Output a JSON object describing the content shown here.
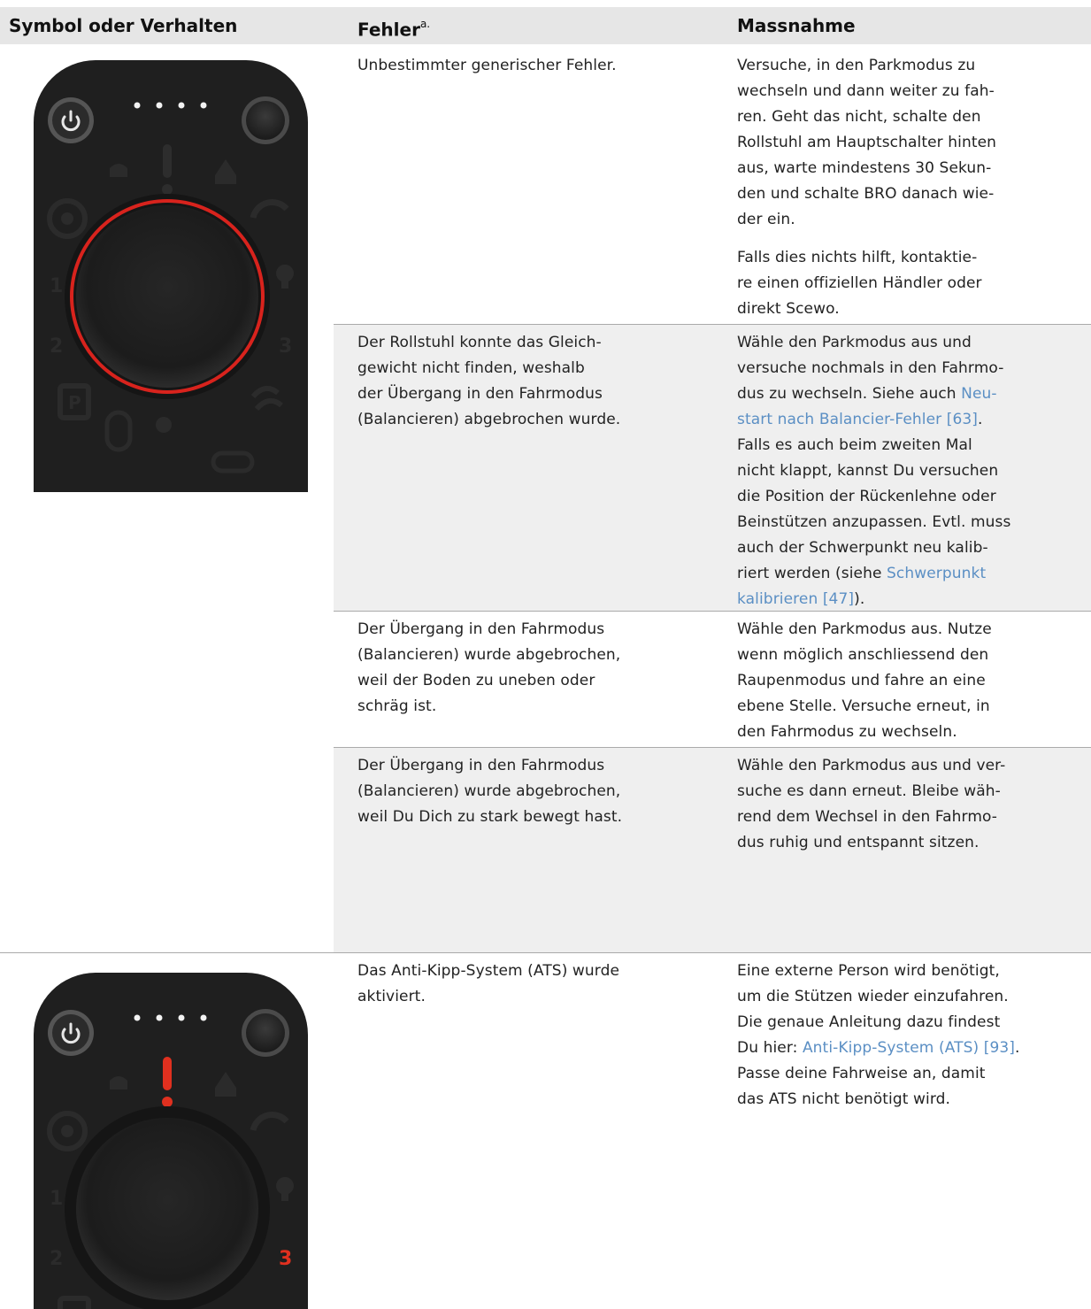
{
  "table": {
    "headers": {
      "symbol": "Symbol oder Verhalten",
      "fehler": "Fehler",
      "fehler_note": "a.",
      "massnahme": "Massnahme"
    },
    "rows": [
      {
        "fehler": "Unbestimmter generischer Fehler.",
        "massnahme_lines": [
          "Versuche, in den Parkmodus zu",
          "wechseln und dann weiter zu fah-",
          "ren. Geht das nicht, schalte den",
          "Rollstuhl am Hauptschalter hinten",
          "aus, warte mindestens 30 Sekun-",
          "den und schalte BRO danach wie-",
          "der ein."
        ],
        "massnahme2_lines": [
          "Falls dies nichts hilft, kontaktie-",
          "re einen offiziellen Händler oder",
          "direkt Scewo."
        ]
      },
      {
        "fehler_lines": [
          "Der Rollstuhl konnte das Gleich-",
          "gewicht nicht finden, weshalb",
          "der Übergang in den Fahrmodus",
          "(Balancieren) abgebrochen wurde."
        ],
        "massnahme": {
          "l1": "Wähle den Parkmodus aus und",
          "l2": "versuche nochmals in den Fahrmo-",
          "l3a": "dus zu wechseln. Siehe auch ",
          "link1a": "Neu-",
          "link1b": "start nach Balancier-Fehler [63]",
          "l4b": ".",
          "l5": "Falls es auch beim zweiten Mal",
          "l6": "nicht klappt, kannst Du versuchen",
          "l7": "die Position der Rückenlehne oder",
          "l8": "Beinstützen anzupassen. Evtl. muss",
          "l9": "auch der Schwerpunkt neu kalib-",
          "l10a": "riert werden (siehe ",
          "link2a": "Schwerpunkt",
          "link2b": "kalibrieren [47]",
          "l11b": ")."
        }
      },
      {
        "fehler_lines": [
          "Der Übergang in den Fahrmodus",
          "(Balancieren) wurde abgebrochen,",
          "weil der Boden zu uneben oder",
          "schräg ist."
        ],
        "massnahme_lines": [
          "Wähle den Parkmodus aus. Nutze",
          "wenn möglich anschliessend den",
          "Raupenmodus und fahre an eine",
          "ebene Stelle. Versuche erneut, in",
          "den Fahrmodus zu wechseln."
        ]
      },
      {
        "fehler_lines": [
          "Der Übergang in den Fahrmodus",
          "(Balancieren) wurde abgebrochen,",
          "weil Du Dich zu stark bewegt hast."
        ],
        "massnahme_lines": [
          "Wähle den Parkmodus aus und ver-",
          "suche es dann erneut. Bleibe wäh-",
          "rend dem Wechsel in den Fahrmo-",
          "dus ruhig und entspannt sitzen."
        ]
      },
      {
        "fehler_lines": [
          "Das Anti-Kipp-System (ATS) wurde",
          "aktiviert."
        ],
        "massnahme": {
          "l1": "Eine externe Person wird benötigt,",
          "l2": "um die Stützen wieder einzufahren.",
          "l3": "Die genaue Anleitung dazu findest",
          "l4a": "Du hier: ",
          "link": "Anti-Kipp-System (ATS) [93]",
          "l4b": ".",
          "l5": "Passe deine Fahrweise an, damit",
          "l6": "das ATS nicht benötigt wird."
        }
      }
    ]
  },
  "devices": [
    {
      "numbers": [
        "1",
        "2",
        "3"
      ],
      "ring_color": "#d8231d",
      "highlight_number": null,
      "warning_lit": false
    },
    {
      "numbers": [
        "1",
        "2",
        "3"
      ],
      "ring_color": null,
      "highlight_number": "3",
      "highlight_color": "#e0301f",
      "warning_lit": true
    }
  ]
}
